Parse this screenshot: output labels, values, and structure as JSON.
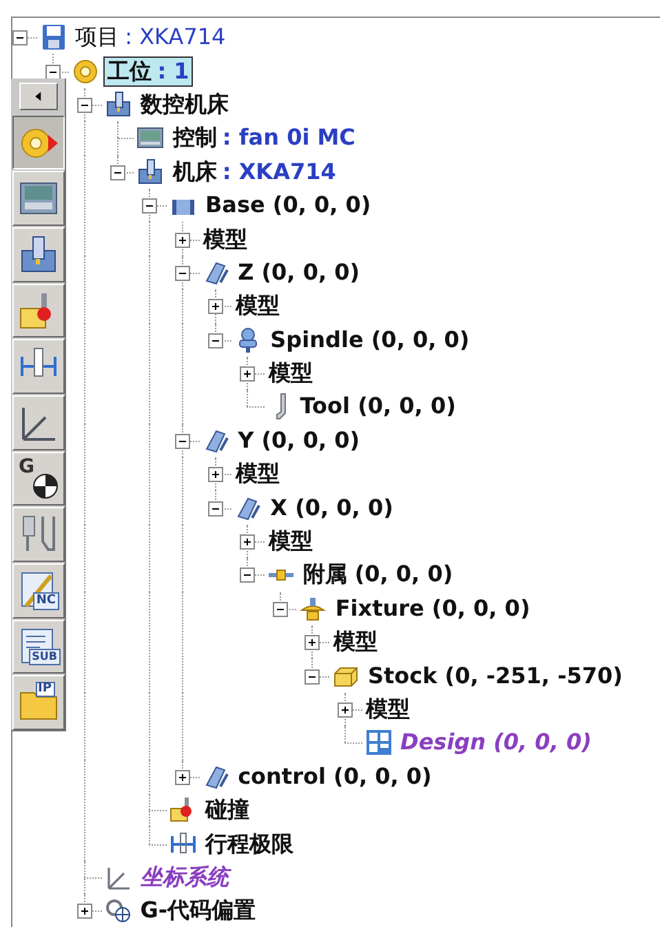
{
  "toolbar": {
    "buttons": [
      {
        "kind": "collapse",
        "selected": false
      },
      {
        "kind": "setup",
        "selected": true
      },
      {
        "kind": "controller",
        "selected": false
      },
      {
        "kind": "machine",
        "selected": false
      },
      {
        "kind": "collision",
        "selected": false
      },
      {
        "kind": "limits",
        "selected": false
      },
      {
        "kind": "coords",
        "selected": false
      },
      {
        "kind": "offsets",
        "selected": false,
        "label": "G"
      },
      {
        "kind": "tools",
        "selected": false
      },
      {
        "kind": "nc",
        "selected": false,
        "label": "NC"
      },
      {
        "kind": "sub",
        "selected": false,
        "label": "SUB"
      },
      {
        "kind": "ip",
        "selected": false,
        "label": "IP"
      }
    ]
  },
  "tree": [
    {
      "kind": "project",
      "label": "项目",
      "value": ": XKA714",
      "expanded": true,
      "selected": false,
      "children": [
        {
          "kind": "setup",
          "label": "工位",
          "value": ": 1",
          "expanded": true,
          "selected": true,
          "children": [
            {
              "kind": "cnc",
              "label": "数控机床",
              "expanded": true,
              "selected": false,
              "children": [
                {
                  "kind": "controller",
                  "label": "控制",
                  "value": ": fan 0i MC",
                  "selected": false
                },
                {
                  "kind": "machine",
                  "label": "机床",
                  "value": ": XKA714",
                  "expanded": true,
                  "selected": false,
                  "children": [
                    {
                      "kind": "base",
                      "label": "Base (0, 0, 0)",
                      "expanded": true,
                      "selected": false,
                      "children": [
                        {
                          "kind": "model",
                          "label": "模型",
                          "expanded": false,
                          "selected": false
                        },
                        {
                          "kind": "axis",
                          "label": "Z (0, 0, 0)",
                          "expanded": true,
                          "selected": false,
                          "children": [
                            {
                              "kind": "model",
                              "label": "模型",
                              "expanded": false,
                              "selected": false
                            },
                            {
                              "kind": "spindle",
                              "label": "Spindle (0, 0, 0)",
                              "expanded": true,
                              "selected": false,
                              "children": [
                                {
                                  "kind": "model",
                                  "label": "模型",
                                  "expanded": false,
                                  "selected": false
                                },
                                {
                                  "kind": "tool",
                                  "label": "Tool (0, 0, 0)",
                                  "selected": false
                                }
                              ]
                            }
                          ]
                        },
                        {
                          "kind": "axis",
                          "label": "Y (0, 0, 0)",
                          "expanded": true,
                          "selected": false,
                          "children": [
                            {
                              "kind": "model",
                              "label": "模型",
                              "expanded": false,
                              "selected": false
                            },
                            {
                              "kind": "axis",
                              "label": "X (0, 0, 0)",
                              "expanded": true,
                              "selected": false,
                              "children": [
                                {
                                  "kind": "model",
                                  "label": "模型",
                                  "expanded": false,
                                  "selected": false
                                },
                                {
                                  "kind": "attachment",
                                  "label": "附属 (0, 0, 0)",
                                  "expanded": true,
                                  "selected": false,
                                  "children": [
                                    {
                                      "kind": "fixture",
                                      "label": "Fixture (0, 0, 0)",
                                      "expanded": true,
                                      "selected": false,
                                      "children": [
                                        {
                                          "kind": "model",
                                          "label": "模型",
                                          "expanded": false,
                                          "selected": false
                                        },
                                        {
                                          "kind": "stock",
                                          "label": "Stock (0, -251, -570)",
                                          "expanded": true,
                                          "selected": false,
                                          "children": [
                                            {
                                              "kind": "model",
                                              "label": "模型",
                                              "expanded": false,
                                              "selected": false
                                            },
                                            {
                                              "kind": "design",
                                              "label": "Design (0, 0, 0)",
                                              "selected": false
                                            }
                                          ]
                                        }
                                      ]
                                    }
                                  ]
                                }
                              ]
                            }
                          ]
                        },
                        {
                          "kind": "component",
                          "label": "control (0, 0, 0)",
                          "expanded": false,
                          "selected": false
                        }
                      ]
                    },
                    {
                      "kind": "collision",
                      "label": "碰撞",
                      "selected": false
                    },
                    {
                      "kind": "limits",
                      "label": "行程极限",
                      "selected": false
                    }
                  ]
                }
              ]
            },
            {
              "kind": "coords",
              "label": "坐标系统",
              "selected": false
            },
            {
              "kind": "offsets",
              "label": "G-代码偏置",
              "expanded": false,
              "selected": false
            }
          ]
        }
      ]
    }
  ]
}
